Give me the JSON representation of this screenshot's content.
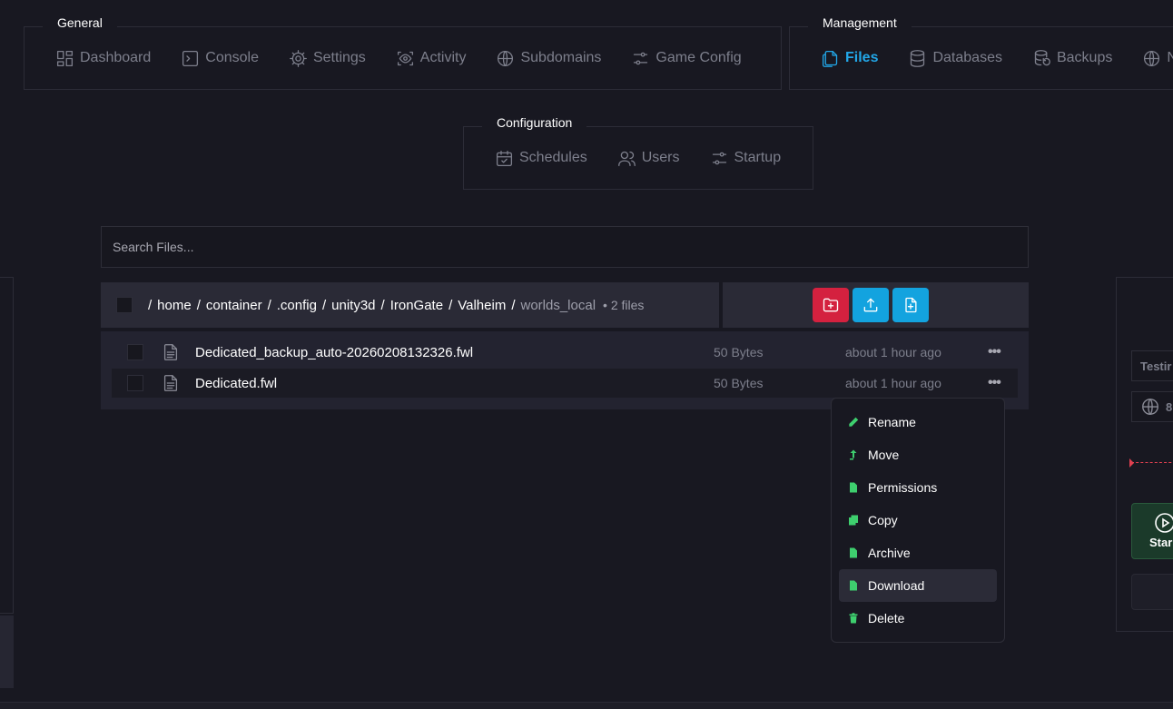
{
  "nav": {
    "general": {
      "title": "General",
      "items": [
        {
          "label": "Dashboard",
          "icon": "dashboard-icon"
        },
        {
          "label": "Console",
          "icon": "console-icon"
        },
        {
          "label": "Settings",
          "icon": "gear-icon"
        },
        {
          "label": "Activity",
          "icon": "activity-eye-icon"
        },
        {
          "label": "Subdomains",
          "icon": "globe-icon"
        },
        {
          "label": "Game Config",
          "icon": "sliders-icon"
        }
      ]
    },
    "management": {
      "title": "Management",
      "items": [
        {
          "label": "Files",
          "icon": "files-icon",
          "active": true
        },
        {
          "label": "Databases",
          "icon": "database-icon"
        },
        {
          "label": "Backups",
          "icon": "backups-icon"
        },
        {
          "label": "N",
          "icon": "globe-icon"
        }
      ]
    },
    "configuration": {
      "title": "Configuration",
      "items": [
        {
          "label": "Schedules",
          "icon": "calendar-icon"
        },
        {
          "label": "Users",
          "icon": "users-icon"
        },
        {
          "label": "Startup",
          "icon": "sliders-icon"
        }
      ]
    }
  },
  "search": {
    "placeholder": "Search Files..."
  },
  "breadcrumb": {
    "segments": [
      "home",
      "container",
      ".config",
      "unity3d",
      "IronGate",
      "Valheim"
    ],
    "current": "worlds_local",
    "count": "• 2 files"
  },
  "actions": {
    "colors": {
      "new_folder": "#d4213f",
      "upload": "#13a3df",
      "new_file": "#13a3df"
    }
  },
  "files": [
    {
      "name": "Dedicated_backup_auto-20260208132326.fwl",
      "size": "50 Bytes",
      "modified": "about 1 hour ago",
      "more": "•••"
    },
    {
      "name": "Dedicated.fwl",
      "size": "50 Bytes",
      "modified": "about 1 hour ago",
      "more": "•••"
    }
  ],
  "context_menu": {
    "items": [
      {
        "label": "Rename",
        "icon": "pencil-icon"
      },
      {
        "label": "Move",
        "icon": "move-arrow-icon"
      },
      {
        "label": "Permissions",
        "icon": "file-permissions-icon"
      },
      {
        "label": "Copy",
        "icon": "copy-icon"
      },
      {
        "label": "Archive",
        "icon": "archive-icon"
      },
      {
        "label": "Download",
        "icon": "download-icon"
      },
      {
        "label": "Delete",
        "icon": "trash-icon"
      }
    ]
  },
  "right_panel": {
    "input_text": "Testir",
    "address_text": "8",
    "start_label": "Star"
  }
}
